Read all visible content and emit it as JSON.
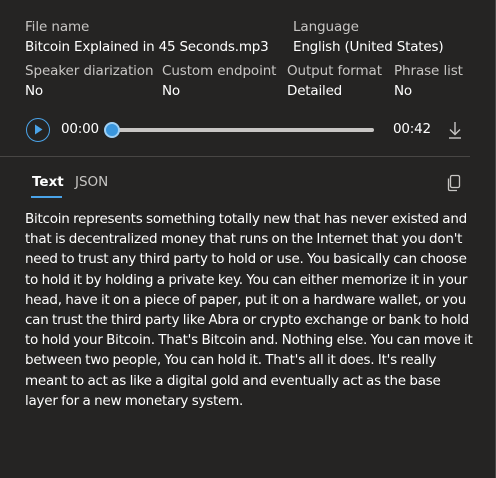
{
  "metadata": {
    "file_name_label": "File name",
    "file_name_value": "Bitcoin Explained in 45 Seconds.mp3",
    "language_label": "Language",
    "language_value": "English (United States)",
    "speaker_diarization_label": "Speaker diarization",
    "speaker_diarization_value": "No",
    "custom_endpoint_label": "Custom endpoint",
    "custom_endpoint_value": "No",
    "output_format_label": "Output format",
    "output_format_value": "Detailed",
    "phrase_list_label": "Phrase list",
    "phrase_list_value": "No"
  },
  "player": {
    "current_time": "00:00",
    "duration": "00:42",
    "progress": 0,
    "play_icon": "play-icon",
    "download_icon": "download-icon"
  },
  "tabs": [
    {
      "label": "Text",
      "active": true
    },
    {
      "label": "JSON",
      "active": false
    }
  ],
  "copy_icon": "copy-icon",
  "transcript": "Bitcoin represents something totally new that has never existed and that is decentralized money that runs on the Internet that you don't need to trust any third party to hold or use. You basically can choose to hold it by holding a private key. You can either memorize it in your head, have it on a piece of paper, put it on a hardware wallet, or you can trust the third party like Abra or crypto exchange or bank to hold to hold your Bitcoin. That's Bitcoin and. Nothing else. You can move it between two people, You can hold it. That's all it does. It's really meant to act as like a digital gold and eventually act as the base layer for a new monetary system.",
  "colors": {
    "background": "#252423",
    "accent": "#4aa3e8",
    "label": "#c8c6c4",
    "text": "#ffffff"
  }
}
